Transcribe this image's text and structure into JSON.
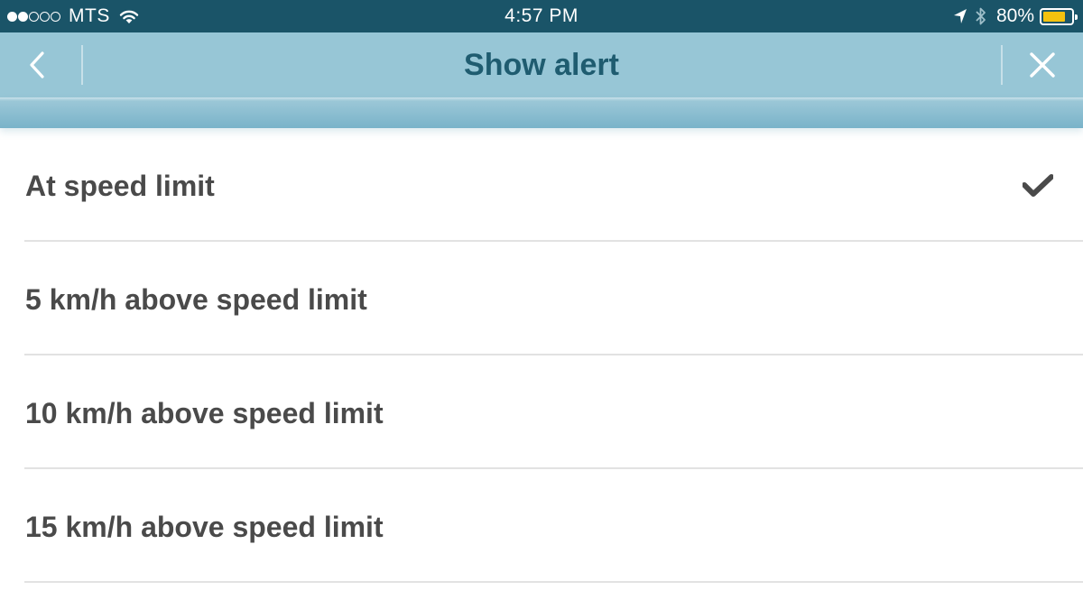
{
  "status_bar": {
    "signal": {
      "filled": 2,
      "total": 5
    },
    "carrier": "MTS",
    "time": "4:57 PM",
    "battery_percent": "80%",
    "battery_level": 0.8,
    "icons": [
      "wifi-icon",
      "location-arrow-icon",
      "bluetooth-icon",
      "battery-icon"
    ]
  },
  "nav": {
    "title": "Show alert",
    "back_icon": "chevron-left-icon",
    "close_icon": "close-icon"
  },
  "options": [
    {
      "label": "At speed limit",
      "selected": true
    },
    {
      "label": "5 km/h above speed limit",
      "selected": false
    },
    {
      "label": "10 km/h above speed limit",
      "selected": false
    },
    {
      "label": "15 km/h above speed limit",
      "selected": false
    }
  ],
  "colors": {
    "status_bar": "#1a5468",
    "nav_bar": "#97c6d6",
    "title": "#1f5c70",
    "item_text": "#4a4a4a",
    "checkmark": "#4a4a4a",
    "battery": "#f4c20f"
  }
}
